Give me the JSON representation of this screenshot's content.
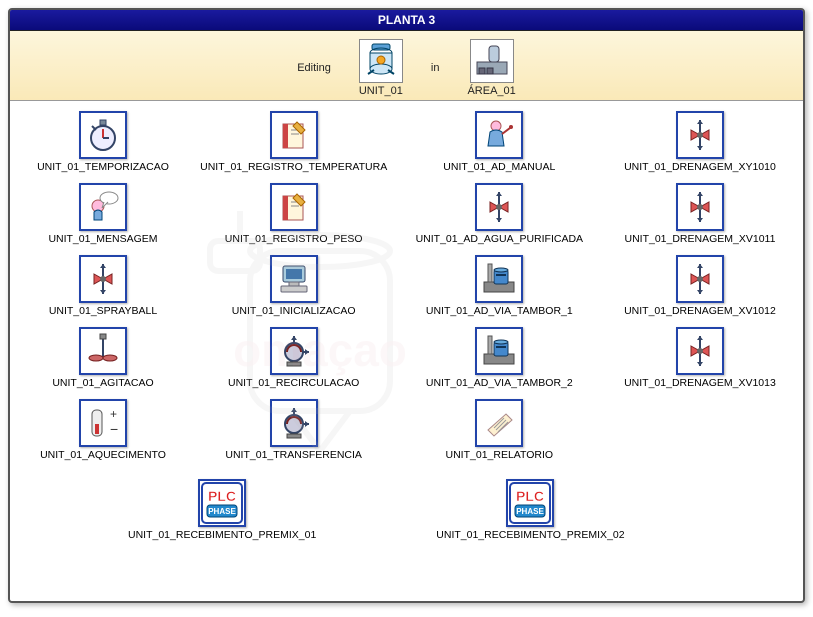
{
  "title": "PLANTA 3",
  "header": {
    "editing_label": "Editing",
    "in_label": "in",
    "unit_label": "UNIT_01",
    "area_label": "ÁREA_01"
  },
  "phases_grid": [
    [
      {
        "label": "UNIT_01_TEMPORIZACAO",
        "icon": "stopwatch"
      },
      {
        "label": "UNIT_01_REGISTRO_TEMPERATURA",
        "icon": "notebook"
      },
      {
        "label": "UNIT_01_AD_MANUAL",
        "icon": "operator"
      },
      {
        "label": "UNIT_01_DRENAGEM_XY1010",
        "icon": "valve"
      }
    ],
    [
      {
        "label": "UNIT_01_MENSAGEM",
        "icon": "message"
      },
      {
        "label": "UNIT_01_REGISTRO_PESO",
        "icon": "notebook"
      },
      {
        "label": "UNIT_01_AD_AGUA_PURIFICADA",
        "icon": "valve"
      },
      {
        "label": "UNIT_01_DRENAGEM_XV1011",
        "icon": "valve"
      }
    ],
    [
      {
        "label": "UNIT_01_SPRAYBALL",
        "icon": "valve"
      },
      {
        "label": "UNIT_01_INICIALIZACAO",
        "icon": "computer"
      },
      {
        "label": "UNIT_01_AD_VIA_TAMBOR_1",
        "icon": "drum"
      },
      {
        "label": "UNIT_01_DRENAGEM_XV1012",
        "icon": "valve"
      }
    ],
    [
      {
        "label": "UNIT_01_AGITACAO",
        "icon": "agitator"
      },
      {
        "label": "UNIT_01_RECIRCULACAO",
        "icon": "pump"
      },
      {
        "label": "UNIT_01_AD_VIA_TAMBOR_2",
        "icon": "drum"
      },
      {
        "label": "UNIT_01_DRENAGEM_XV1013",
        "icon": "valve"
      }
    ],
    [
      {
        "label": "UNIT_01_AQUECIMENTO",
        "icon": "heater"
      },
      {
        "label": "UNIT_01_TRANSFERENCIA",
        "icon": "pump"
      },
      {
        "label": "UNIT_01_RELATORIO",
        "icon": "report"
      },
      {
        "label": "",
        "icon": ""
      }
    ]
  ],
  "phases_bottom": [
    {
      "label": "UNIT_01_RECEBIMENTO_PREMIX_01",
      "icon": "plc"
    },
    {
      "label": "UNIT_01_RECEBIMENTO_PREMIX_02",
      "icon": "plc"
    }
  ]
}
